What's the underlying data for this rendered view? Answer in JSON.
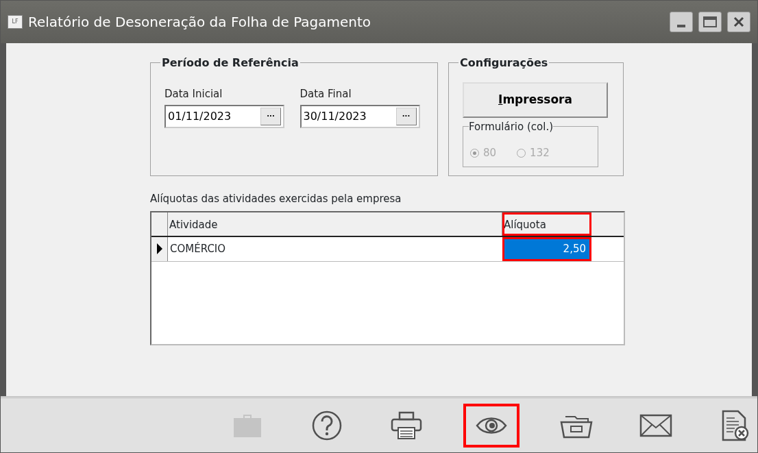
{
  "window": {
    "title": "Relatório de Desoneração da Folha de Pagamento",
    "logo": "LF"
  },
  "periodo": {
    "title": "Período de Referência",
    "fields": [
      {
        "label": "Data Inicial",
        "value": "01/11/2023",
        "button": "···"
      },
      {
        "label": "Data Final",
        "value": "30/11/2023",
        "button": "···"
      }
    ]
  },
  "configuracoes": {
    "title": "Configurações",
    "printer_button": "Impressora",
    "form_group": {
      "title": "Formulário (col.)",
      "disabled": true,
      "options": [
        {
          "label": "80",
          "selected": true
        },
        {
          "label": "132",
          "selected": false
        }
      ]
    }
  },
  "table": {
    "caption": "Alíquotas das atividades exercidas pela empresa",
    "columns": [
      {
        "label": "Atividade",
        "highlighted": false
      },
      {
        "label": "Alíquota",
        "highlighted": true
      }
    ],
    "rows": [
      {
        "current": true,
        "cells": [
          {
            "text": "COMÉRCIO",
            "selected": false
          },
          {
            "text": "2,50",
            "selected": true
          }
        ]
      }
    ]
  },
  "toolbar": [
    {
      "kind": "briefcase",
      "disabled": true,
      "highlighted": false
    },
    {
      "kind": "help",
      "disabled": false,
      "highlighted": false
    },
    {
      "kind": "printer",
      "disabled": false,
      "highlighted": false
    },
    {
      "kind": "eye",
      "disabled": false,
      "highlighted": true
    },
    {
      "kind": "folder",
      "disabled": false,
      "highlighted": false
    },
    {
      "kind": "envelope",
      "disabled": false,
      "highlighted": false
    },
    {
      "kind": "document-close",
      "disabled": false,
      "highlighted": false
    }
  ]
}
